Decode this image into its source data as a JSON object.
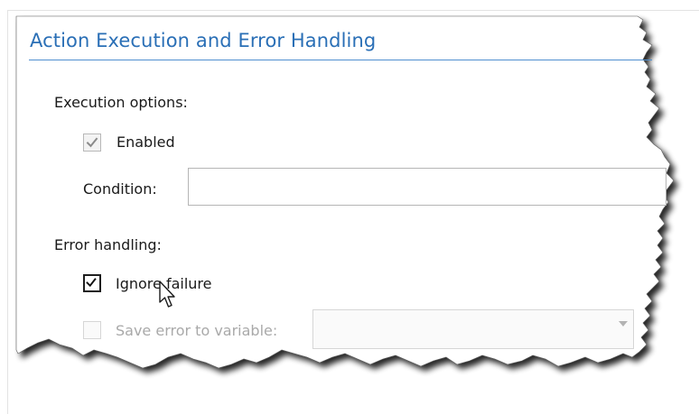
{
  "section": {
    "title": "Action Execution and Error Handling"
  },
  "execution": {
    "heading": "Execution options:",
    "enabled_label": "Enabled",
    "enabled_checked": true,
    "condition_label": "Condition:",
    "condition_value": ""
  },
  "error_handling": {
    "heading": "Error handling:",
    "ignore_failure_label": "Ignore failure",
    "ignore_failure_checked": true,
    "save_error_label": "Save error to variable:",
    "save_error_checked": false,
    "variable_value": ""
  },
  "colors": {
    "title": "#2a6fb6",
    "title_rule": "#4f8fcf",
    "disabled_text": "#a9a9a9"
  },
  "icons": {
    "cursor": "mouse-pointer-icon",
    "check": "checkmark-icon"
  }
}
